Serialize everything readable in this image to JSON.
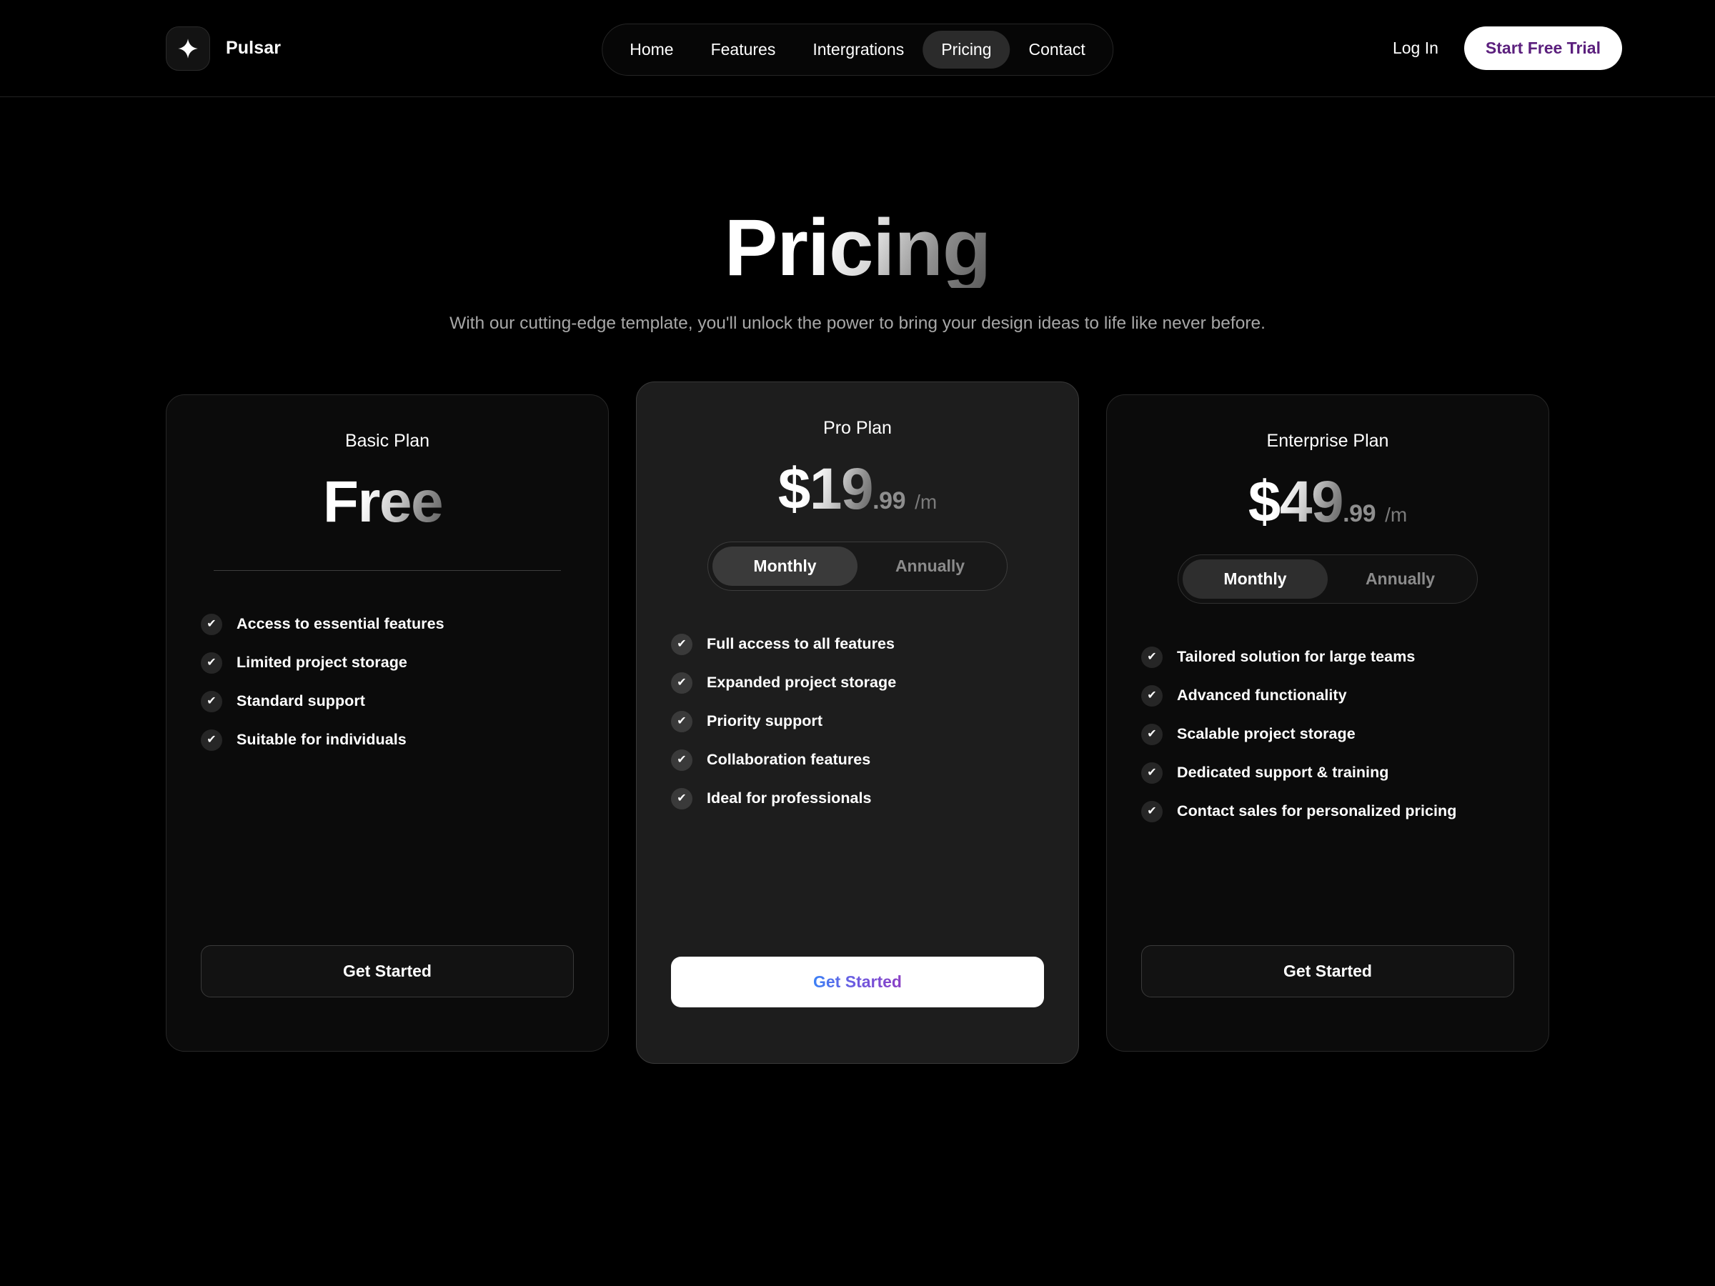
{
  "header": {
    "brand": {
      "name": "Pulsar",
      "icon": "sparkle-icon"
    },
    "nav": [
      {
        "label": "Home",
        "active": false
      },
      {
        "label": "Features",
        "active": false
      },
      {
        "label": "Intergrations",
        "active": false
      },
      {
        "label": "Pricing",
        "active": true
      },
      {
        "label": "Contact",
        "active": false
      }
    ],
    "login_label": "Log In",
    "trial_label": "Start Free Trial",
    "trial_text_color": "#5b1f7d"
  },
  "hero": {
    "title": "Pricing",
    "subtitle": "With our cutting-edge template, you'll unlock the power to bring your design ideas to life like never before."
  },
  "plans": [
    {
      "name": "Basic Plan",
      "price_main": "Free",
      "price_cents": "",
      "price_period": "",
      "has_toggle": false,
      "has_divider": true,
      "featured": false,
      "features": [
        "Access to essential features",
        "Limited project storage",
        "Standard support",
        "Suitable for individuals"
      ],
      "cta_label": "Get Started"
    },
    {
      "name": "Pro Plan",
      "price_main": "$19",
      "price_cents": ".99",
      "price_period": "/m",
      "has_toggle": true,
      "has_divider": false,
      "featured": true,
      "billing_options": [
        {
          "label": "Monthly",
          "selected": true
        },
        {
          "label": "Annually",
          "selected": false
        }
      ],
      "features": [
        "Full access to all features",
        "Expanded project storage",
        "Priority support",
        "Collaboration features",
        "Ideal for professionals"
      ],
      "cta_label": "Get Started"
    },
    {
      "name": "Enterprise Plan",
      "price_main": "$49",
      "price_cents": ".99",
      "price_period": "/m",
      "has_toggle": true,
      "has_divider": false,
      "featured": false,
      "billing_options": [
        {
          "label": "Monthly",
          "selected": true
        },
        {
          "label": "Annually",
          "selected": false
        }
      ],
      "features": [
        "Tailored solution for large teams",
        "Advanced functionality",
        "Scalable project storage",
        "Dedicated support & training",
        "Contact sales for personalized pricing"
      ],
      "cta_label": "Get Started"
    }
  ],
  "colors": {
    "page_background": "#000000",
    "card_background": "#0b0b0b",
    "featured_card_background": "#1d1d1d",
    "accent_purple": "#5b1f7d",
    "cta_gradient_start": "#3b82f6",
    "cta_gradient_end": "#8b3fc4"
  },
  "icons": {
    "check": "✔"
  }
}
